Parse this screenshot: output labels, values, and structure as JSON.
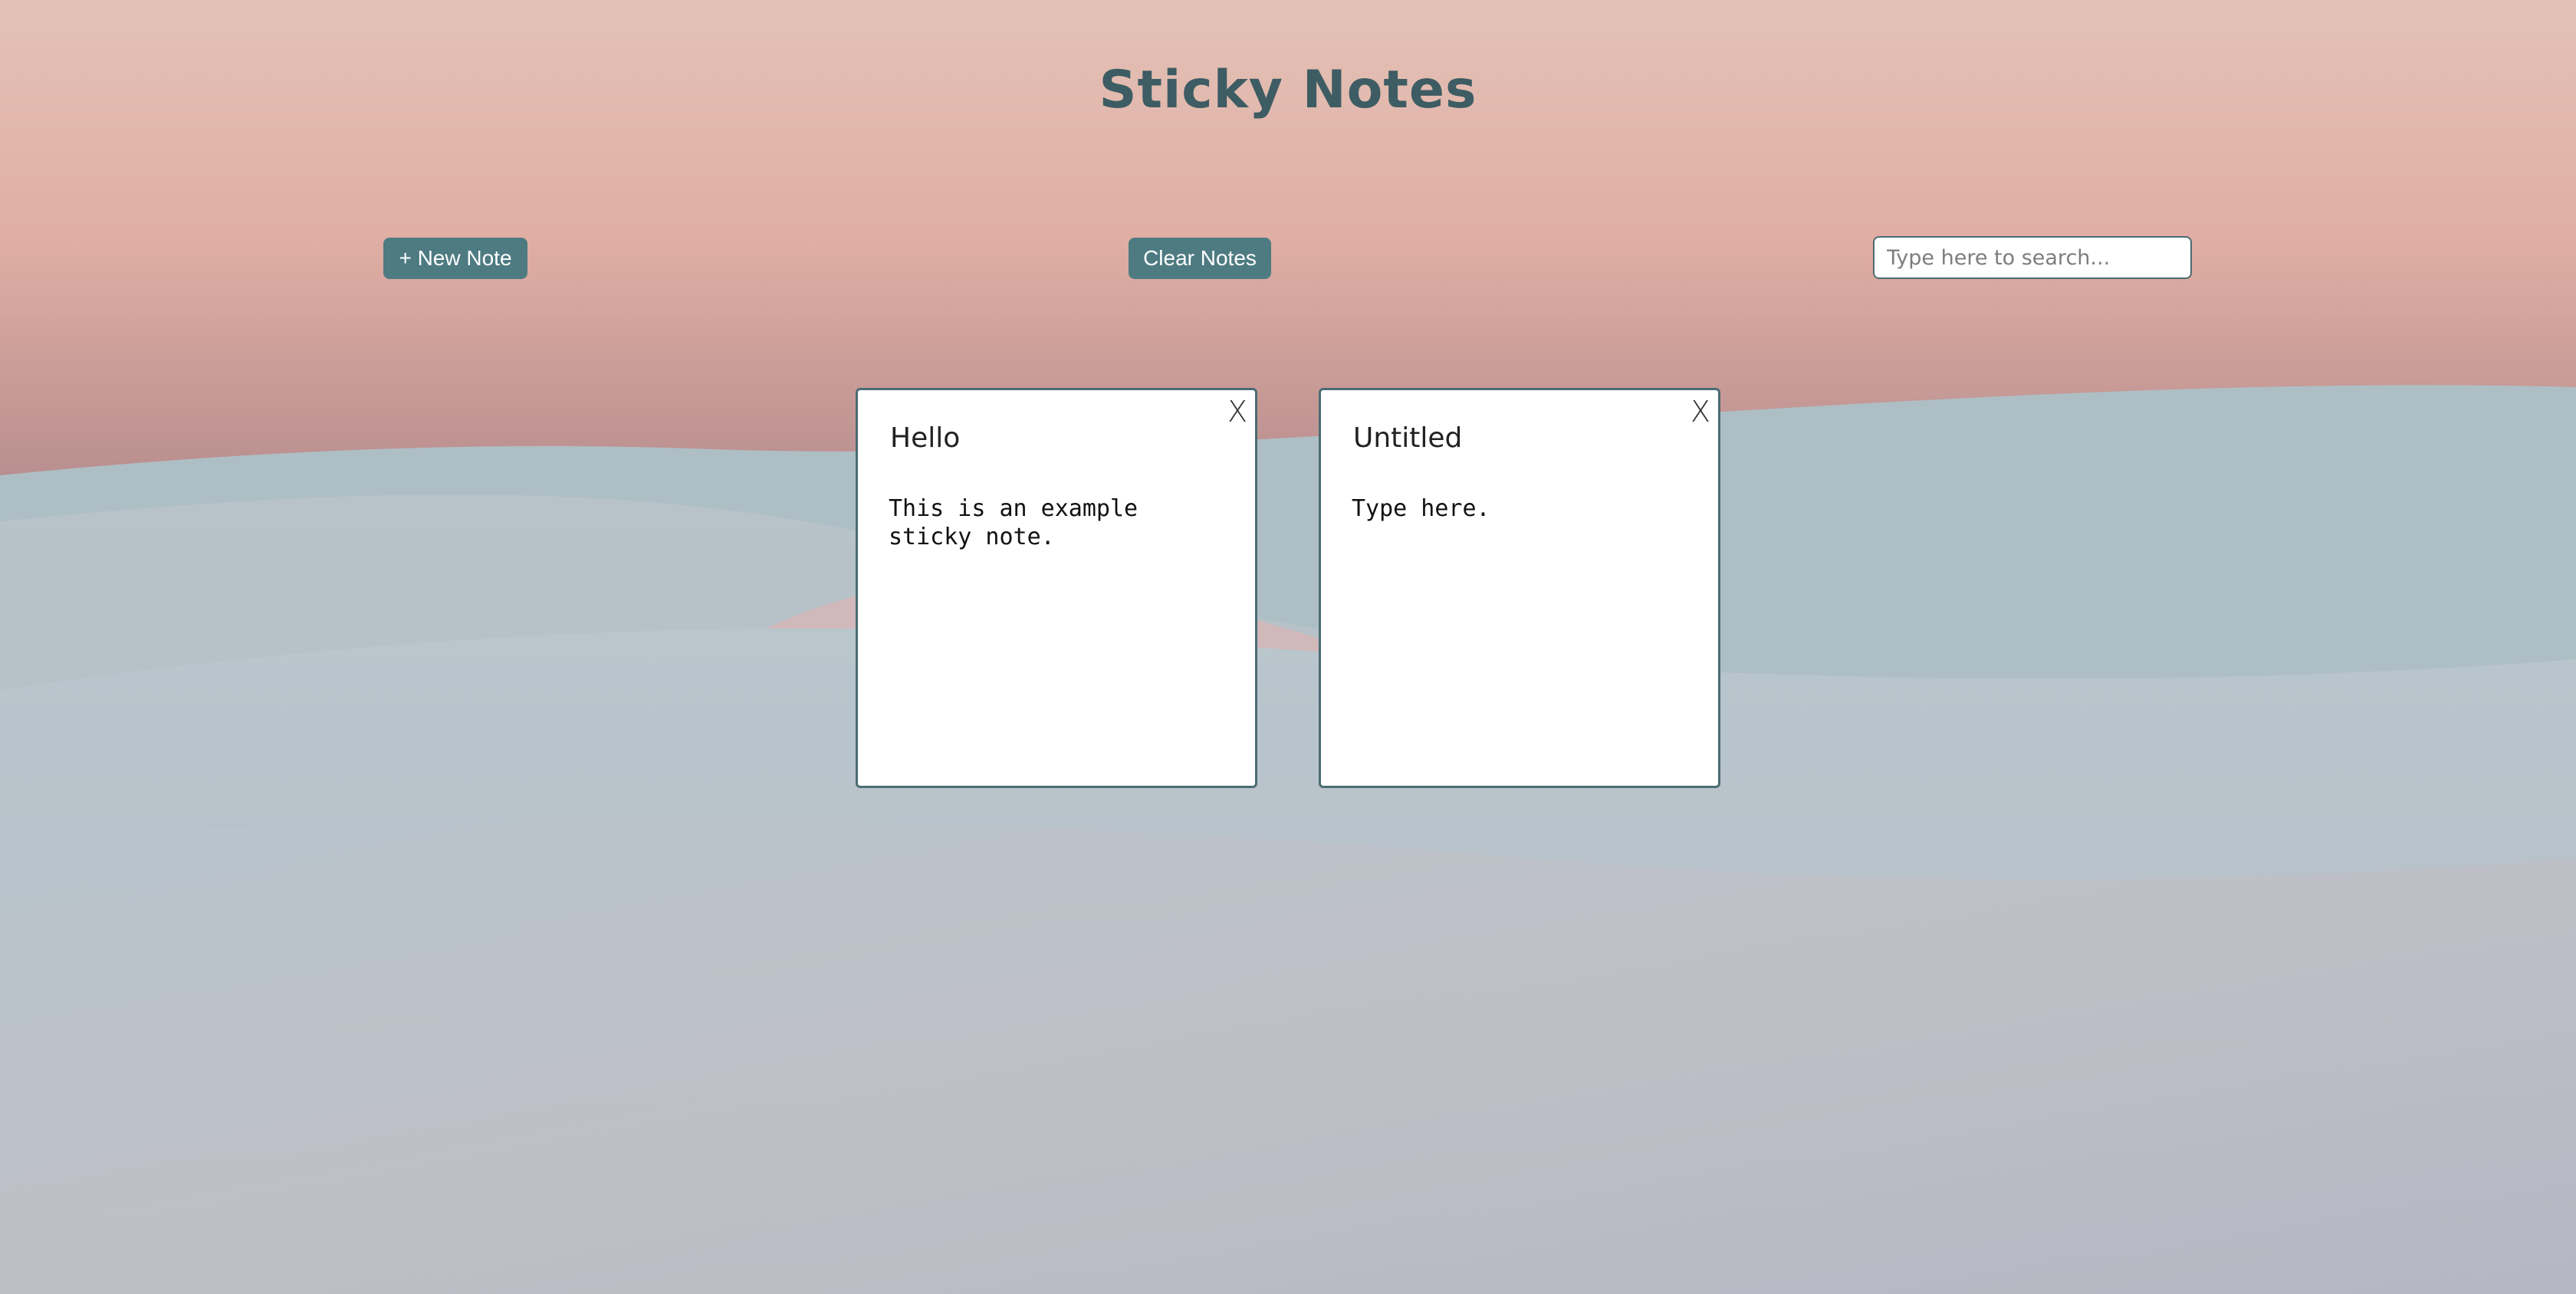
{
  "app": {
    "title": "Sticky Notes"
  },
  "toolbar": {
    "new_note_label": "+ New Note",
    "clear_notes_label": "Clear Notes",
    "search_placeholder": "Type here to search...",
    "search_value": ""
  },
  "notes": [
    {
      "title": "Hello",
      "body": "This is an example\nsticky note.",
      "close_label": "X"
    },
    {
      "title": "Untitled",
      "body": "Type here.",
      "close_label": "X"
    }
  ],
  "colors": {
    "accent": "#4e7b82",
    "title": "#3d5c63",
    "note_border": "#4b6c73"
  }
}
